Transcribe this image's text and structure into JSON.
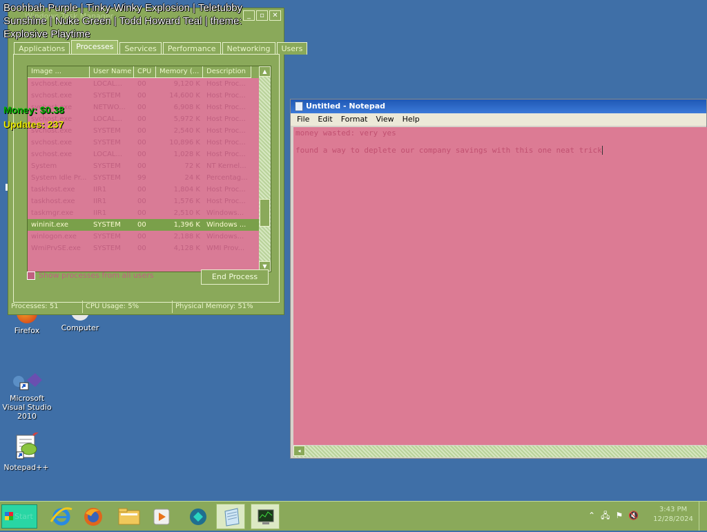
{
  "overlay": {
    "title": "Boohbah Purple | Tinky-Winky Explosion | Teletubby Sunshine | Nuke Green | Todd Howard Teal | theme: Explosive Playtime",
    "money": "Money: $0.38",
    "updates": "Updates: 237"
  },
  "desktop_icons": [
    {
      "label": "Firefox"
    },
    {
      "label": "Computer"
    },
    {
      "label": "Microsoft Visual Studio 2010"
    },
    {
      "label": "Notepad++"
    }
  ],
  "task_manager": {
    "title": "Windows Task Manager",
    "tabs": [
      "Applications",
      "Processes",
      "Services",
      "Performance",
      "Networking",
      "Users"
    ],
    "active_tab": "Processes",
    "columns": [
      "Image ...",
      "User Name",
      "CPU",
      "Memory (...",
      "Description"
    ],
    "rows": [
      {
        "image": "svchost.exe",
        "user": "LOCAL...",
        "cpu": "00",
        "mem": "9,120 K",
        "desc": "Host Proc..."
      },
      {
        "image": "svchost.exe",
        "user": "SYSTEM",
        "cpu": "00",
        "mem": "14,600 K",
        "desc": "Host Proc..."
      },
      {
        "image": "svchost.exe",
        "user": "NETWO...",
        "cpu": "00",
        "mem": "6,908 K",
        "desc": "Host Proc..."
      },
      {
        "image": "svchost.exe",
        "user": "LOCAL...",
        "cpu": "00",
        "mem": "5,972 K",
        "desc": "Host Proc..."
      },
      {
        "image": "svchost.exe",
        "user": "SYSTEM",
        "cpu": "00",
        "mem": "2,540 K",
        "desc": "Host Proc..."
      },
      {
        "image": "svchost.exe",
        "user": "SYSTEM",
        "cpu": "00",
        "mem": "10,896 K",
        "desc": "Host Proc..."
      },
      {
        "image": "svchost.exe",
        "user": "LOCAL...",
        "cpu": "00",
        "mem": "1,028 K",
        "desc": "Host Proc..."
      },
      {
        "image": "System",
        "user": "SYSTEM",
        "cpu": "00",
        "mem": "72 K",
        "desc": "NT Kernel..."
      },
      {
        "image": "System Idle Pr...",
        "user": "SYSTEM",
        "cpu": "99",
        "mem": "24 K",
        "desc": "Percentag..."
      },
      {
        "image": "taskhost.exe",
        "user": "IIR1",
        "cpu": "00",
        "mem": "1,804 K",
        "desc": "Host Proc..."
      },
      {
        "image": "taskhost.exe",
        "user": "IIR1",
        "cpu": "00",
        "mem": "1,576 K",
        "desc": "Host Proc..."
      },
      {
        "image": "taskmgr.exe",
        "user": "IIR1",
        "cpu": "00",
        "mem": "2,510 K",
        "desc": "Windows..."
      },
      {
        "image": "wininit.exe",
        "user": "SYSTEM",
        "cpu": "00",
        "mem": "1,396 K",
        "desc": "Windows ...",
        "selected": true
      },
      {
        "image": "winlogon.exe",
        "user": "SYSTEM",
        "cpu": "00",
        "mem": "2,188 K",
        "desc": "Windows..."
      },
      {
        "image": "WmiPrvSE.exe",
        "user": "SYSTEM",
        "cpu": "00",
        "mem": "4,128 K",
        "desc": "WMI Prov..."
      }
    ],
    "show_all_label": "Show processes from all users",
    "end_process_label": "End Process",
    "status": {
      "processes": "Processes: 51",
      "cpu": "CPU Usage: 5%",
      "memory": "Physical Memory: 51%"
    }
  },
  "notepad": {
    "title": "Untitled - Notepad",
    "menu": [
      "File",
      "Edit",
      "Format",
      "View",
      "Help"
    ],
    "lines": [
      "money wasted: very yes",
      "found a way to deplete our company savings with this one neat trick"
    ]
  },
  "taskbar": {
    "start_label": "Start",
    "items": [
      "internet-explorer",
      "firefox",
      "file-explorer",
      "media-player",
      "visual-studio",
      "notepad",
      "task-manager"
    ],
    "clock_time": "3:43 PM",
    "clock_date": "12/28/2024"
  },
  "colors": {
    "desktop": "#3f6fa7",
    "window_green": "#8aa95a",
    "content_pink": "#dc7b94"
  }
}
